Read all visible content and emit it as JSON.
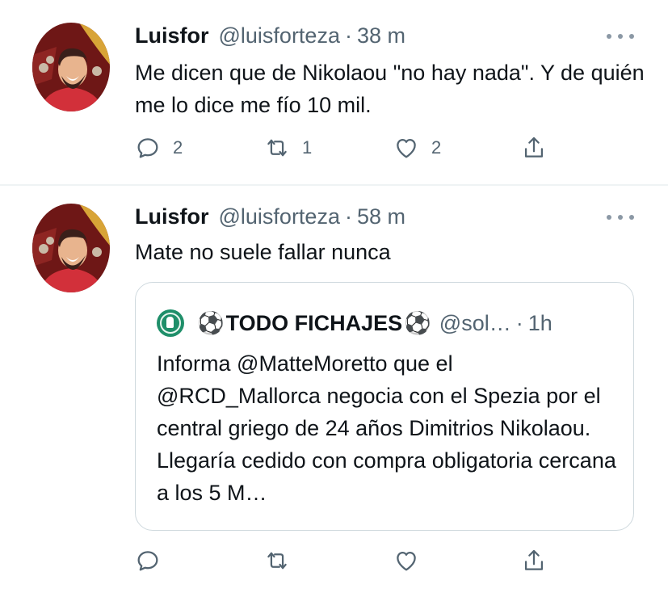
{
  "tweets": [
    {
      "author_name": "Luisfor",
      "handle": "@luisforteza",
      "separator": "·",
      "time": "38 m",
      "text": "Me dicen que de Nikolaou \"no hay nada\". Y de quién me lo dice me fío 10 mil.",
      "reply_count": "2",
      "retweet_count": "1",
      "like_count": "2"
    },
    {
      "author_name": "Luisfor",
      "handle": "@luisforteza",
      "separator": "·",
      "time": "58 m",
      "text": "Mate no suele fallar nunca",
      "quote": {
        "ball_left": "⚽",
        "name": "TODO FICHAJES",
        "ball_right": "⚽",
        "handle": "@sol…",
        "separator": "·",
        "time": "1h",
        "text": "Informa @MatteMoretto que el @RCD_Mallorca negocia con el Spezia por el central griego de 24 años Dimitrios Nikolaou. Llegaría cedido con compra obligatoria cercana a los 5 M…"
      }
    }
  ],
  "icons": {
    "reply": "speech-bubble-icon",
    "retweet": "retweet-arrows-icon",
    "like": "heart-outline-icon",
    "share": "share-upload-icon",
    "more": "more-dots-icon"
  },
  "colors": {
    "text_primary": "#0f1419",
    "text_secondary": "#536471",
    "border": "#cfd9de",
    "divider": "#eff3f4"
  }
}
